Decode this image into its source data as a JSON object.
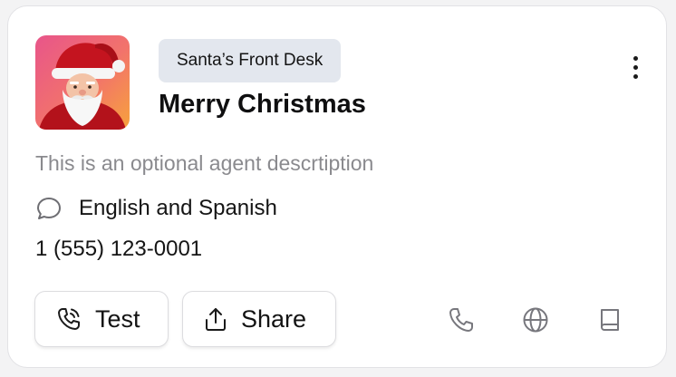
{
  "agent": {
    "tag": "Santa’s Front Desk",
    "name": "Merry Christmas",
    "description": "This is an optional agent descrtiption",
    "languages": "English and Spanish",
    "phone": "1 (555) 123-0001"
  },
  "actions": {
    "test_label": "Test",
    "share_label": "Share"
  },
  "icons": {
    "menu": "more-vertical-icon",
    "chat": "chat-bubble-icon",
    "test": "phone-call-icon",
    "share": "share-upload-icon",
    "phone": "phone-icon",
    "web": "globe-icon",
    "knowledge": "book-icon"
  },
  "colors": {
    "tag_bg": "#e3e7ee",
    "text_primary": "#0f0f10",
    "text_secondary": "#8a8a8e",
    "icon_muted": "#7a7a80"
  }
}
